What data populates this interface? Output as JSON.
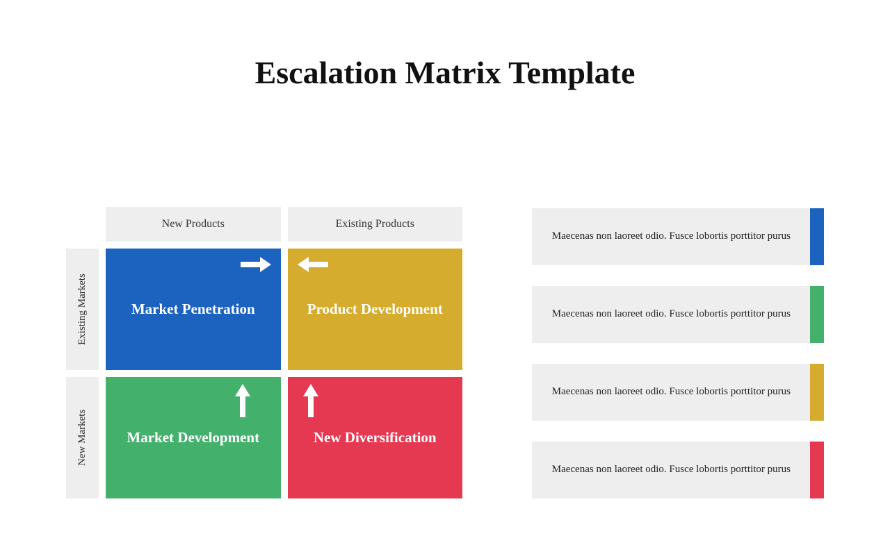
{
  "title": "Escalation Matrix Template",
  "matrix": {
    "colHeaders": [
      "New Products",
      "Existing Products"
    ],
    "rowHeaders": [
      "Existing Markets",
      "New Markets"
    ],
    "cells": [
      {
        "label": "Market Penetration",
        "color": "#1c62bf",
        "arrow": "right"
      },
      {
        "label": "Product Development",
        "color": "#d5ac2d",
        "arrow": "left"
      },
      {
        "label": "Market Development",
        "color": "#43b16c",
        "arrow": "up"
      },
      {
        "label": "New Diversification",
        "color": "#e53952",
        "arrow": "up"
      }
    ]
  },
  "legend": [
    {
      "text": "Maecenas non laoreet odio. Fusce lobortis porttitor purus",
      "color": "#1c62bf"
    },
    {
      "text": "Maecenas non laoreet odio. Fusce lobortis porttitor purus",
      "color": "#43b16c"
    },
    {
      "text": "Maecenas non laoreet odio. Fusce lobortis porttitor purus",
      "color": "#d5ac2d"
    },
    {
      "text": "Maecenas non laoreet odio. Fusce lobortis porttitor purus",
      "color": "#e53952"
    }
  ]
}
